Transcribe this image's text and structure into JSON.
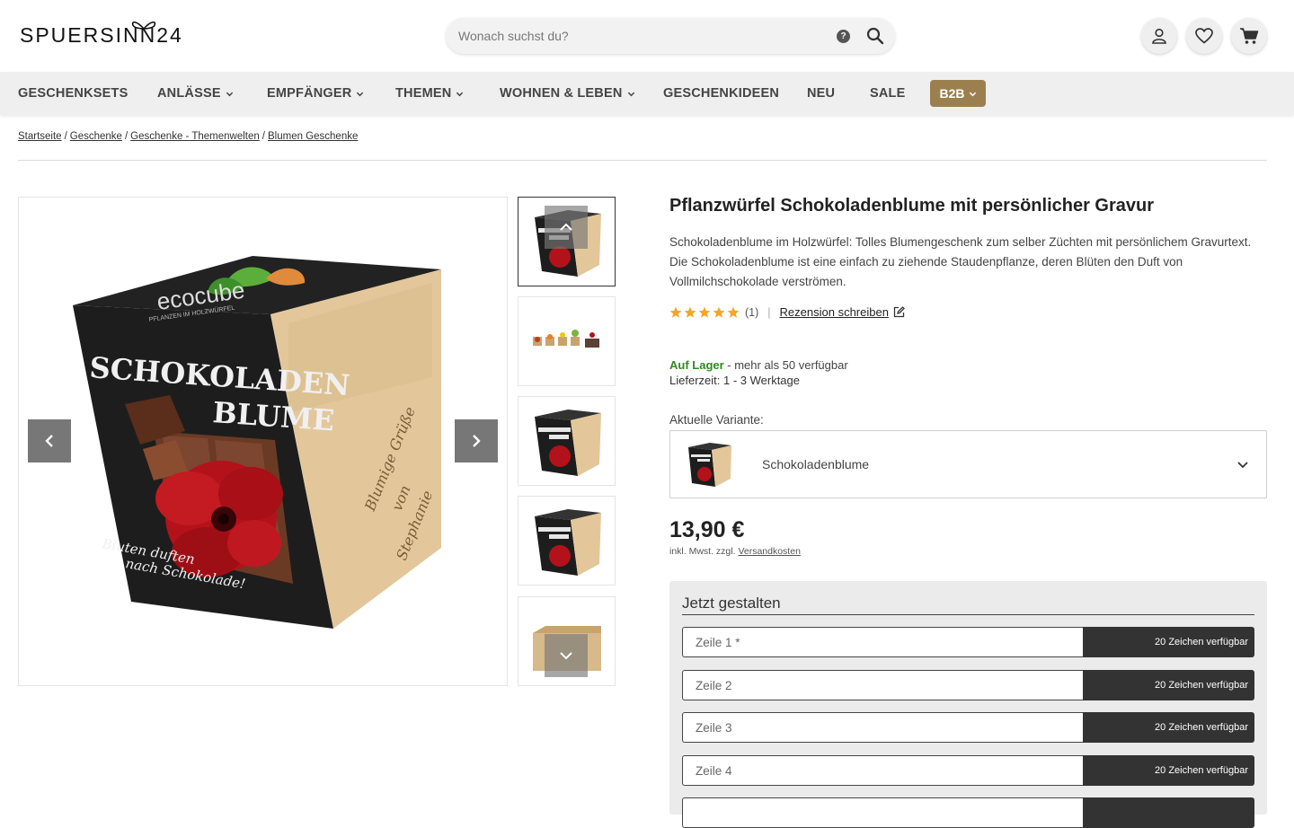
{
  "header": {
    "logo_text": "SPUERSINN24",
    "search_placeholder": "Wonach suchst du?",
    "help_label": "?"
  },
  "nav": {
    "items": [
      {
        "label": "GESCHENKSETS"
      },
      {
        "label": "ANLÄSSE"
      },
      {
        "label": "EMPFÄNGER"
      },
      {
        "label": "THEMEN"
      },
      {
        "label": "WOHNEN & LEBEN"
      },
      {
        "label": "GESCHENKIDEEN"
      },
      {
        "label": "NEU"
      },
      {
        "label": "SALE"
      }
    ],
    "b2b_label": "B2B"
  },
  "breadcrumb": [
    {
      "label": "Startseite"
    },
    {
      "label": "Geschenke"
    },
    {
      "label": "Geschenke - Themenwelten"
    },
    {
      "label": "Blumen Geschenke"
    }
  ],
  "product": {
    "image_text_brand": "ecocube",
    "image_text_sub": "PFLANZEN IM HOLZWÜRFEL",
    "image_text_title_1": "SCHOKOLADEN",
    "image_text_title_2": "BLUME",
    "image_text_side_1": "Bluten duften",
    "image_text_side_2": "nach Schokolade!",
    "image_text_engrave_1": "Blumige Grüße",
    "image_text_engrave_2": "von",
    "image_text_engrave_3": "Stephanie",
    "title": "Pflanzwürfel Schokoladenblume mit persönlicher Gravur",
    "description": "Schokoladenblume im Holzwürfel: Tolles Blumengeschenk zum selber Züchten mit persönlichem Gravurtext. Die Schokoladenblume ist eine einfach zu ziehende Staudenpflanze, deren Blüten den Duft von Vollmilchschokolade verströmen.",
    "rating_count": "(1)",
    "rating_separator": "|",
    "review_link": "Rezension schreiben",
    "stock_status": "Auf Lager",
    "stock_detail": " - mehr als 50 verfügbar",
    "delivery": "Lieferzeit: 1 - 3 Werktage",
    "variant_label": "Aktuelle Variante:",
    "variant_value": "Schokoladenblume",
    "price": "13,90 €",
    "tax_text": "inkl. Mwst. zzgl. ",
    "shipping_link": "Versandkosten"
  },
  "colors": {
    "stars": "#f5a623",
    "accent_b2b": "#9b7f4e",
    "in_stock": "#2e8b1f"
  },
  "config": {
    "title": "Jetzt gestalten",
    "lines": [
      {
        "placeholder": "Zeile 1 *",
        "available": "20 Zeichen verfügbar"
      },
      {
        "placeholder": "Zeile 2",
        "available": "20 Zeichen verfügbar"
      },
      {
        "placeholder": "Zeile 3",
        "available": "20 Zeichen verfügbar"
      },
      {
        "placeholder": "Zeile 4",
        "available": "20 Zeichen verfügbar"
      },
      {
        "placeholder": "",
        "available": ""
      }
    ]
  }
}
